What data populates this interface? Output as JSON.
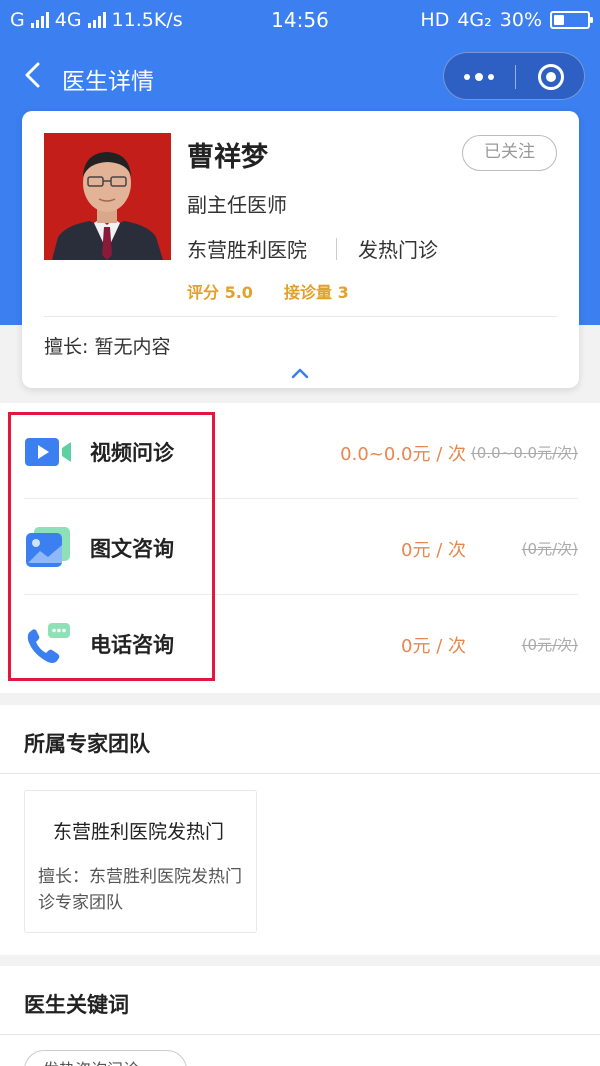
{
  "status_bar": {
    "carrier": "G",
    "network": "4G",
    "speed": "11.5K/s",
    "time": "14:56",
    "hd": "HD",
    "network2": "4G₂",
    "battery": "30%",
    "battery_level": 0.3
  },
  "nav": {
    "title": "医生详情",
    "back_icon": "chevron-left-icon",
    "more_icon": "more-dots-icon",
    "close_icon": "target-circle-icon"
  },
  "doctor": {
    "name": "曹祥梦",
    "title": "副主任医师",
    "hospital": "东营胜利医院",
    "department": "发热门诊",
    "rating": "评分 5.0",
    "consultations": "接诊量 3",
    "follow_label": "已关注",
    "specialty": "擅长: 暂无内容",
    "expand_icon": "chevron-up-icon"
  },
  "services": [
    {
      "name": "视频问诊",
      "price": "0.0~0.0元 / 次",
      "original": "(0.0~0.0元/次)",
      "icon": "video-camera-icon"
    },
    {
      "name": "图文咨询",
      "price": "0元 / 次",
      "original": "(0元/次)",
      "icon": "image-icon"
    },
    {
      "name": "电话咨询",
      "price": "0元 / 次",
      "original": "(0元/次)",
      "icon": "phone-chat-icon"
    }
  ],
  "team_section": {
    "title": "所属专家团队",
    "team_name": "东营胜利医院发热门",
    "team_desc": "擅长：东营胜利医院发热门诊专家团队"
  },
  "keywords_section": {
    "title": "医生关键词",
    "tag": "发热咨询问诊"
  },
  "colors": {
    "primary": "#3b7ff0",
    "price": "#e8874f",
    "rating": "#e2a12a",
    "highlight": "#e3163c"
  }
}
